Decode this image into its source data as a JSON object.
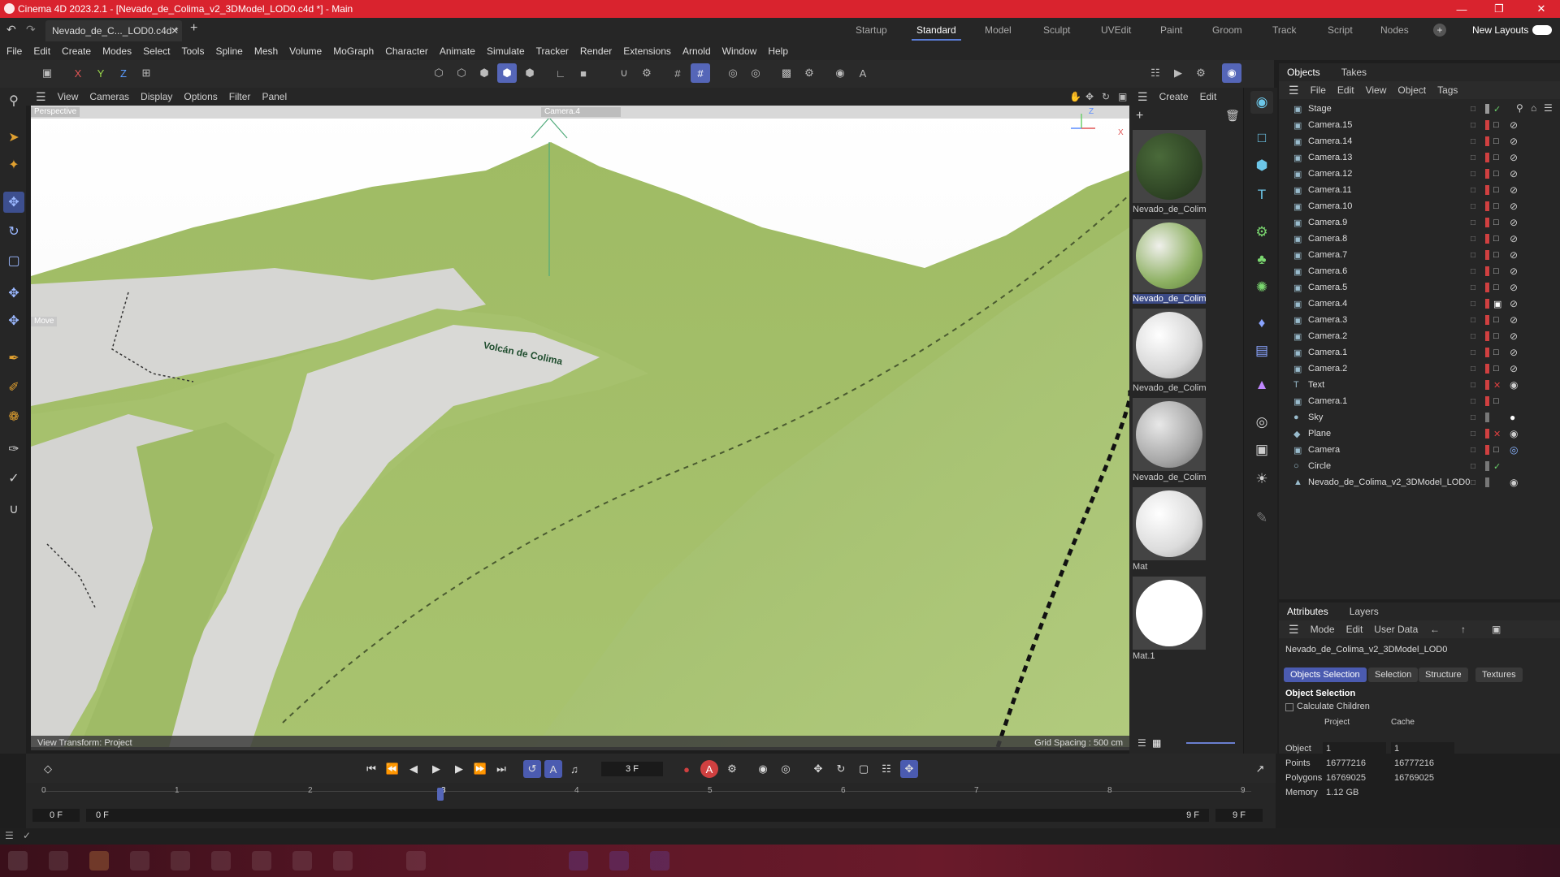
{
  "window": {
    "title": "Cinema 4D 2023.2.1 - [Nevado_de_Colima_v2_3DModel_LOD0.c4d *] - Main"
  },
  "tabs": {
    "doc_tab": "Nevado_de_C..._LOD0.c4d *",
    "layouts": [
      "Startup",
      "Standard",
      "Model",
      "Sculpt",
      "UVEdit",
      "Paint",
      "Groom",
      "Track",
      "Script",
      "Nodes"
    ],
    "active_layout": "Standard",
    "new_layouts": "New Layouts"
  },
  "menu": [
    "File",
    "Edit",
    "Create",
    "Modes",
    "Select",
    "Tools",
    "Spline",
    "Mesh",
    "Volume",
    "MoGraph",
    "Character",
    "Animate",
    "Simulate",
    "Tracker",
    "Render",
    "Extensions",
    "Arnold",
    "Window",
    "Help"
  ],
  "viewport": {
    "menu": [
      "View",
      "Cameras",
      "Display",
      "Options",
      "Filter",
      "Panel"
    ],
    "view_name": "Perspective",
    "camera": "Camera.4",
    "tool_hint": "Move",
    "label_3d": "Volcán de Colima",
    "view_transform": "View Transform: Project",
    "grid_spacing": "Grid Spacing : 500 cm",
    "axis_labels": {
      "y": "Y",
      "z": "Z",
      "x": "X"
    }
  },
  "materials": {
    "menu": [
      "Create",
      "Edit"
    ],
    "items": [
      "Nevado_de_Colim",
      "Nevado_de_Colim",
      "Nevado_de_Colim",
      "Nevado_de_Colim",
      "Mat",
      "Mat.1"
    ],
    "selected_index": 1
  },
  "objects": {
    "tabs": [
      "Objects",
      "Takes"
    ],
    "menu": [
      "File",
      "Edit",
      "View",
      "Object",
      "Tags"
    ],
    "rows": [
      {
        "name": "Stage",
        "icon": "stage-icon",
        "tag": "check"
      },
      {
        "name": "Camera.15",
        "icon": "camera-icon",
        "tag": "ban"
      },
      {
        "name": "Camera.14",
        "icon": "camera-icon",
        "tag": "ban"
      },
      {
        "name": "Camera.13",
        "icon": "camera-icon",
        "tag": "ban"
      },
      {
        "name": "Camera.12",
        "icon": "camera-icon",
        "tag": "ban"
      },
      {
        "name": "Camera.11",
        "icon": "camera-icon",
        "tag": "ban"
      },
      {
        "name": "Camera.10",
        "icon": "camera-icon",
        "tag": "ban"
      },
      {
        "name": "Camera.9",
        "icon": "camera-icon",
        "tag": "ban"
      },
      {
        "name": "Camera.8",
        "icon": "camera-icon",
        "tag": "ban"
      },
      {
        "name": "Camera.7",
        "icon": "camera-icon",
        "tag": "ban"
      },
      {
        "name": "Camera.6",
        "icon": "camera-icon",
        "tag": "ban"
      },
      {
        "name": "Camera.5",
        "icon": "camera-icon",
        "tag": "ban"
      },
      {
        "name": "Camera.4",
        "icon": "camera-icon",
        "tag": "ban"
      },
      {
        "name": "Camera.3",
        "icon": "camera-icon",
        "tag": "ban"
      },
      {
        "name": "Camera.2",
        "icon": "camera-icon",
        "tag": "ban"
      },
      {
        "name": "Camera.1",
        "icon": "camera-icon",
        "tag": "ban"
      },
      {
        "name": "Camera.2",
        "icon": "camera-icon",
        "tag": "ban"
      },
      {
        "name": "Text",
        "icon": "text-icon",
        "tag": "x"
      },
      {
        "name": "Camera.1",
        "icon": "camera-icon",
        "tag": ""
      },
      {
        "name": "Sky",
        "icon": "sky-icon",
        "tag": ""
      },
      {
        "name": "Plane",
        "icon": "plane-icon",
        "tag": "x"
      },
      {
        "name": "Camera",
        "icon": "camera-icon",
        "tag": ""
      },
      {
        "name": "Circle",
        "icon": "circle-icon",
        "tag": "check"
      },
      {
        "name": "Nevado_de_Colima_v2_3DModel_LOD0",
        "icon": "mesh-icon",
        "tag": ""
      }
    ]
  },
  "attributes": {
    "tabs": [
      "Attributes",
      "Layers"
    ],
    "menu": [
      "Mode",
      "Edit",
      "User Data"
    ],
    "object_name": "Nevado_de_Colima_v2_3DModel_LOD0",
    "buttons": [
      "Objects Selection",
      "Selection",
      "Structure",
      "Textures"
    ],
    "section": "Object Selection",
    "checkbox": "Calculate Children",
    "col_headers": [
      "Project",
      "Cache"
    ],
    "stats": [
      {
        "label": "Object",
        "project": "1",
        "cache": "1"
      },
      {
        "label": "Points",
        "project": "16777216",
        "cache": "16777216"
      },
      {
        "label": "Polygons",
        "project": "16769025",
        "cache": "16769025"
      },
      {
        "label": "Memory",
        "project": "1.12 GB",
        "cache": ""
      }
    ]
  },
  "timeline": {
    "current_frame": "3 F",
    "ruler": [
      "0",
      "1",
      "2",
      "3",
      "4",
      "5",
      "6",
      "7",
      "8",
      "9"
    ],
    "current": 3,
    "start": "0 F",
    "preview_start": "0 F",
    "preview_end": "9 F",
    "end": "9 F"
  },
  "colors": {
    "titlebar": "#d9232e",
    "accent": "#5566b8",
    "terrain_green": "#a9c46f",
    "terrain_snow": "#d8d8d6"
  }
}
